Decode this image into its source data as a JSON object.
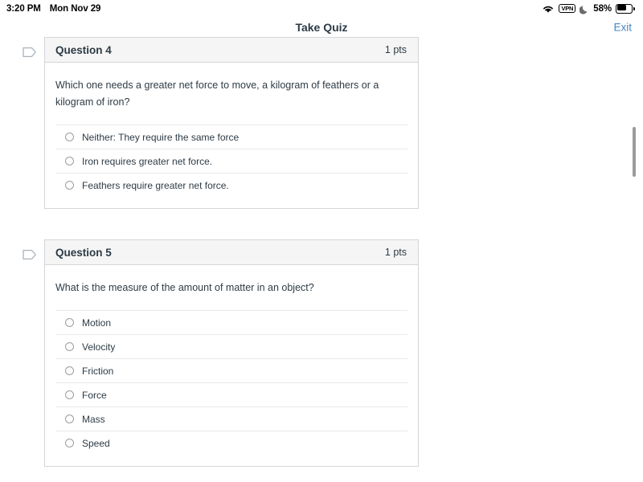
{
  "status_bar": {
    "time": "3:20 PM",
    "date": "Mon Nov 29",
    "wifi_icon": "wifi-icon",
    "vpn_label": "VPN",
    "dnd_icon": "moon-icon",
    "battery_percent": "58%",
    "battery_icon": "battery-icon"
  },
  "header": {
    "title": "Take Quiz",
    "exit_label": "Exit",
    "exit_color": "#4a86c8"
  },
  "scrollbar": {
    "name": "vertical-scrollbar"
  },
  "questions": [
    {
      "flag_icon": "flag-outline-icon",
      "title": "Question 4",
      "points": "1 pts",
      "text": "Which one needs a greater net force to move, a kilogram of feathers or a kilogram of iron?",
      "answers": [
        "Neither: They require the same force",
        "Iron requires greater net force.",
        "Feathers require greater net force."
      ]
    },
    {
      "flag_icon": "flag-outline-icon",
      "title": "Question 5",
      "points": "1 pts",
      "text": "What is the measure of the amount of matter in an object?",
      "answers": [
        "Motion",
        "Velocity",
        "Friction",
        "Force",
        "Mass",
        "Speed"
      ]
    }
  ]
}
